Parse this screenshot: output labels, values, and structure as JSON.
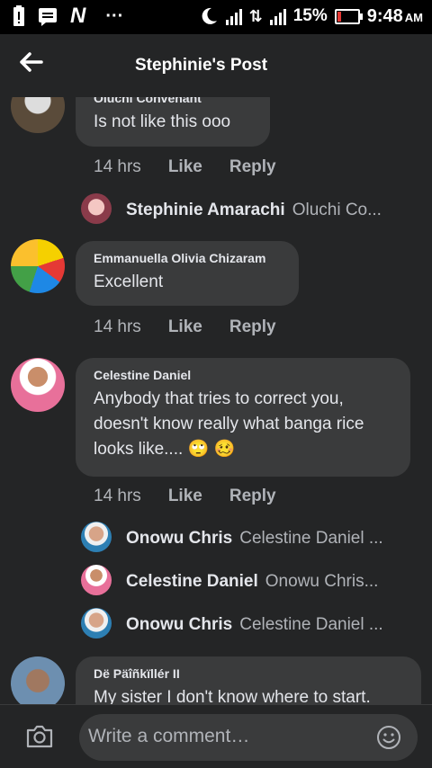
{
  "status_bar": {
    "battery_percent": "15%",
    "time": "9:48",
    "ampm": "AM",
    "icons": [
      "battery-alert-icon",
      "message-icon",
      "n-app-icon",
      "more-dots-icon",
      "moon-icon",
      "signal-1-icon",
      "data-arrows-icon",
      "signal-2-icon",
      "battery-icon"
    ]
  },
  "header": {
    "back_icon": "arrow-left-icon",
    "title": "Stephinie's Post"
  },
  "comments": [
    {
      "author": "Oluchi Convenant",
      "text": "Is not like this ooo",
      "time": "14 hrs",
      "like": "Like",
      "reply": "Reply",
      "replies": [
        {
          "author": "Stephinie Amarachi",
          "preview": "Oluchi Co..."
        }
      ]
    },
    {
      "author": "Emmanuella Olivia Chizaram",
      "text": "Excellent",
      "time": "14 hrs",
      "like": "Like",
      "reply": "Reply",
      "replies": []
    },
    {
      "author": "Celestine Daniel",
      "text_line1": "Anybody that tries to correct you,",
      "text_line2": "doesn't know really what banga rice",
      "text_line3": "looks like.... 🙄 🥴",
      "time": "14 hrs",
      "like": "Like",
      "reply": "Reply",
      "replies": [
        {
          "author": "Onowu Chris",
          "preview": "Celestine Daniel ..."
        },
        {
          "author": "Celestine Daniel",
          "preview": "Onowu Chris..."
        },
        {
          "author": "Onowu Chris",
          "preview": "Celestine Daniel ..."
        }
      ]
    },
    {
      "author": "Dë Päîñkïllér II",
      "text": "My sister I don't know where to start."
    }
  ],
  "composer": {
    "placeholder": "Write a comment…",
    "camera_icon": "camera-icon",
    "emoji_icon": "emoji-icon"
  }
}
